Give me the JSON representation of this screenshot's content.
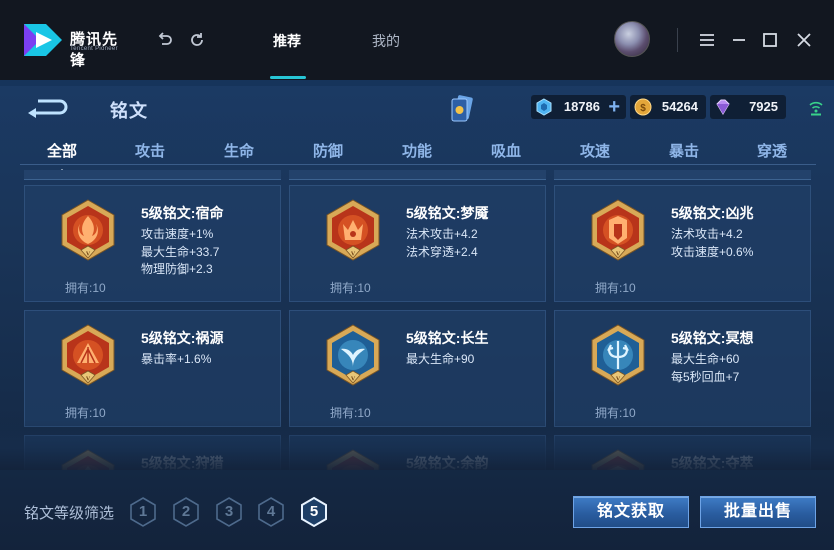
{
  "app": {
    "name": "腾讯先锋",
    "subtitle": "Tencent Pioneer",
    "tabs": [
      {
        "label": "推荐",
        "active": true
      },
      {
        "label": "我的",
        "active": false
      }
    ]
  },
  "panel": {
    "title": "铭文",
    "currencies": [
      {
        "icon": "blue-gem-icon",
        "value": "18786"
      },
      {
        "icon": "gold-coin-icon",
        "value": "54264"
      },
      {
        "icon": "purple-diamond-icon",
        "value": "7925"
      }
    ],
    "categories": [
      "全部",
      "攻击",
      "生命",
      "防御",
      "功能",
      "吸血",
      "攻速",
      "暴击",
      "穿透"
    ],
    "active_category": "全部"
  },
  "inscriptions": [
    {
      "name": "5级铭文:宿命",
      "stats": [
        "攻击速度+1%",
        "最大生命+33.7",
        "物理防御+2.3"
      ],
      "owned": "拥有:10",
      "color": "red",
      "emblem": "flame-emblem-icon"
    },
    {
      "name": "5级铭文:梦魇",
      "stats": [
        "法术攻击+4.2",
        "法术穿透+2.4"
      ],
      "owned": "拥有:10",
      "color": "red",
      "emblem": "demon-emblem-icon"
    },
    {
      "name": "5级铭文:凶兆",
      "stats": [
        "法术攻击+4.2",
        "攻击速度+0.6%"
      ],
      "owned": "拥有:10",
      "color": "red",
      "emblem": "crown-emblem-icon"
    },
    {
      "name": "5级铭文:祸源",
      "stats": [
        "暴击率+1.6%"
      ],
      "owned": "拥有:10",
      "color": "red",
      "emblem": "fan-emblem-icon"
    },
    {
      "name": "5级铭文:长生",
      "stats": [
        "最大生命+90"
      ],
      "owned": "拥有:10",
      "color": "blue",
      "emblem": "whale-tail-emblem-icon"
    },
    {
      "name": "5级铭文:冥想",
      "stats": [
        "最大生命+60",
        "每5秒回血+7"
      ],
      "owned": "拥有:10",
      "color": "blue",
      "emblem": "trident-emblem-icon"
    },
    {
      "name": "5级铭文:狩猎",
      "stats": [],
      "owned": "",
      "color": "red",
      "emblem": "emblem-icon"
    },
    {
      "name": "5级铭文:余韵",
      "stats": [],
      "owned": "",
      "color": "red",
      "emblem": "emblem-icon"
    },
    {
      "name": "5级铭文:夺萃",
      "stats": [],
      "owned": "",
      "color": "red",
      "emblem": "emblem-icon"
    }
  ],
  "bottom": {
    "filter_label": "铭文等级筛选",
    "levels": [
      "1",
      "2",
      "3",
      "4",
      "5"
    ],
    "active_level": "5",
    "obtain_button": "铭文获取",
    "sell_button": "批量出售"
  },
  "colors": {
    "accent_cyan": "#27c6d6",
    "panel_blue": "#1b3a64",
    "button_blue": "#3f7cc6",
    "red_emblem": "#d2451f",
    "blue_emblem": "#3b8fc9",
    "gold_frame": "#d8a957"
  }
}
